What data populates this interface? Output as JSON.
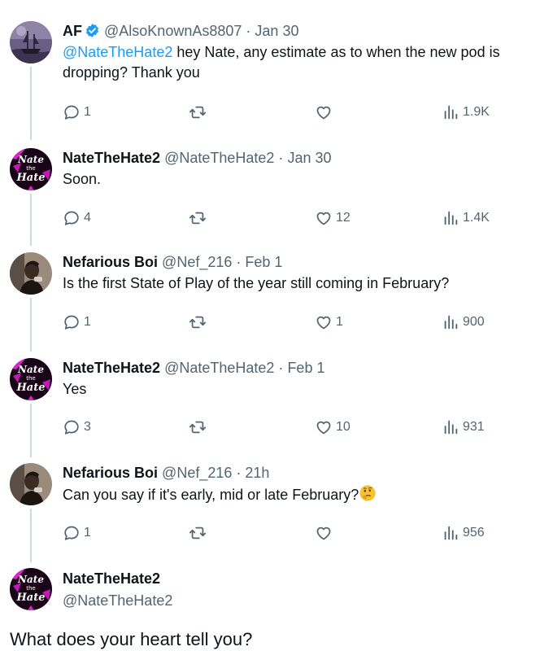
{
  "thread": [
    {
      "author": "AF",
      "verified": true,
      "handle": "@AlsoKnownAs8807",
      "separator": "·",
      "time": "Jan 30",
      "mention": "@NateTheHate2",
      "text": " hey Nate, any estimate as to when the new pod is dropping? Thank you",
      "avatar": "ship-avatar",
      "replies": "1",
      "retweets": "",
      "likes": "",
      "views": "1.9K"
    },
    {
      "author": "NateTheHate2",
      "verified": false,
      "handle": "@NateTheHate2",
      "separator": "·",
      "time": "Jan 30",
      "mention": "",
      "text": "Soon.",
      "avatar": "nate-logo-avatar",
      "replies": "4",
      "retweets": "",
      "likes": "12",
      "views": "1.4K"
    },
    {
      "author": "Nefarious Boi",
      "verified": false,
      "handle": "@Nef_216",
      "separator": "·",
      "time": "Feb 1",
      "mention": "",
      "text": "Is the first State of Play of the year still coming in February?",
      "avatar": "person-avatar",
      "replies": "1",
      "retweets": "",
      "likes": "1",
      "views": "900"
    },
    {
      "author": "NateTheHate2",
      "verified": false,
      "handle": "@NateTheHate2",
      "separator": "·",
      "time": "Feb 1",
      "mention": "",
      "text": "Yes",
      "avatar": "nate-logo-avatar",
      "replies": "3",
      "retweets": "",
      "likes": "10",
      "views": "931"
    },
    {
      "author": "Nefarious Boi",
      "verified": false,
      "handle": "@Nef_216",
      "separator": "·",
      "time": "21h",
      "mention": "",
      "text": "Can you say if it's early, mid or late February?",
      "emoji": "thinking-face-emoji",
      "avatar": "person-avatar",
      "replies": "1",
      "retweets": "",
      "likes": "",
      "views": "956"
    }
  ],
  "main_tweet": {
    "author": "NateTheHate2",
    "handle": "@NateTheHate2",
    "text": "What does your heart tell you?",
    "avatar": "nate-logo-avatar"
  },
  "avatar_logo_text": [
    "Nate",
    "the",
    "Hate"
  ],
  "colors": {
    "link": "#1d9bf0",
    "secondary_text": "#536471",
    "thread_line": "#cfd9de",
    "verified_badge": "#1d9bf0",
    "logo_background": "#e020d0"
  },
  "icons": {
    "reply": "reply-icon",
    "retweet": "retweet-icon",
    "like": "like-icon",
    "views": "views-icon"
  }
}
